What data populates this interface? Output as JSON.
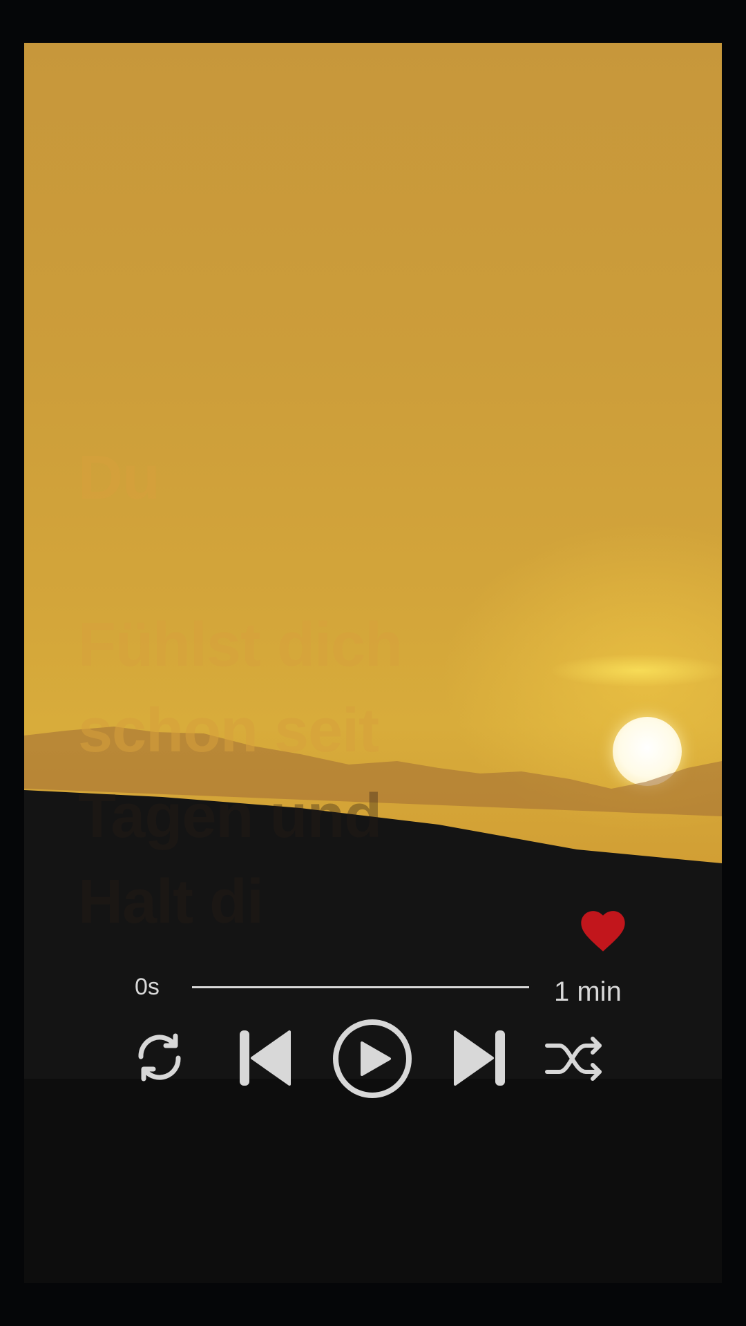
{
  "background": {
    "sky_colors": [
      "#c7973b",
      "#d8ac3b",
      "#b8862c"
    ],
    "ground_color": "#121212",
    "sun_color": "#ffffff"
  },
  "lyrics": {
    "lines": [
      "Du",
      "Fühlst dich",
      "schon seit",
      "Tagen und",
      "Halt di"
    ],
    "color": "#d7a03c"
  },
  "like": {
    "icon": "heart-icon",
    "color": "#c2161c"
  },
  "player": {
    "time_elapsed": "0s",
    "time_total": "1 min",
    "progress": 0.0,
    "controls": {
      "repeat_icon": "repeat-icon",
      "previous_icon": "skip-previous-icon",
      "play_icon": "play-icon",
      "next_icon": "skip-next-icon",
      "shuffle_icon": "shuffle-icon"
    },
    "control_color": "#d8d8d8"
  }
}
